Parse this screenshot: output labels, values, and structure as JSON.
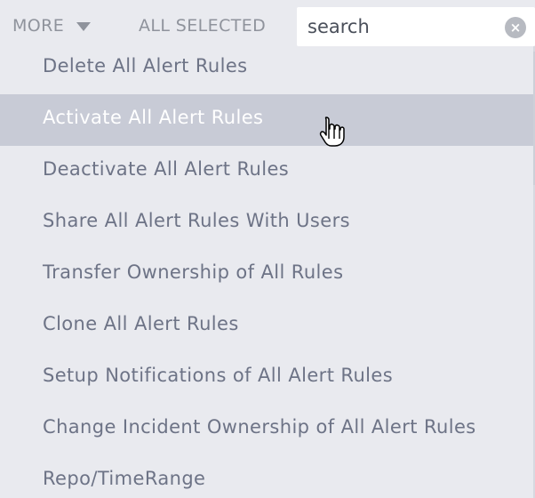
{
  "toolbar": {
    "more_label": "MORE",
    "more_icon": "caret-down-icon",
    "all_selected_label": "ALL SELECTED",
    "search": {
      "value": "search",
      "placeholder": "search",
      "clear_icon": "close-circle-icon"
    }
  },
  "menu": {
    "active_index": 1,
    "items": [
      {
        "label": "Delete All Alert Rules"
      },
      {
        "label": "Activate All Alert Rules"
      },
      {
        "label": "Deactivate All Alert Rules"
      },
      {
        "label": "Share All Alert Rules With Users"
      },
      {
        "label": "Transfer Ownership of All Rules"
      },
      {
        "label": "Clone All Alert Rules"
      },
      {
        "label": "Setup Notifications of All Alert Rules"
      },
      {
        "label": "Change Incident Ownership of All Alert Rules"
      },
      {
        "label": "Repo/TimeRange"
      }
    ]
  },
  "colors": {
    "background": "#e9eaef",
    "muted_text": "#8f939c",
    "menu_text": "#6d7386",
    "highlight_background": "#c8cbd6",
    "highlight_text": "#ffffff"
  },
  "cursor_icon": "hand-pointer-icon"
}
